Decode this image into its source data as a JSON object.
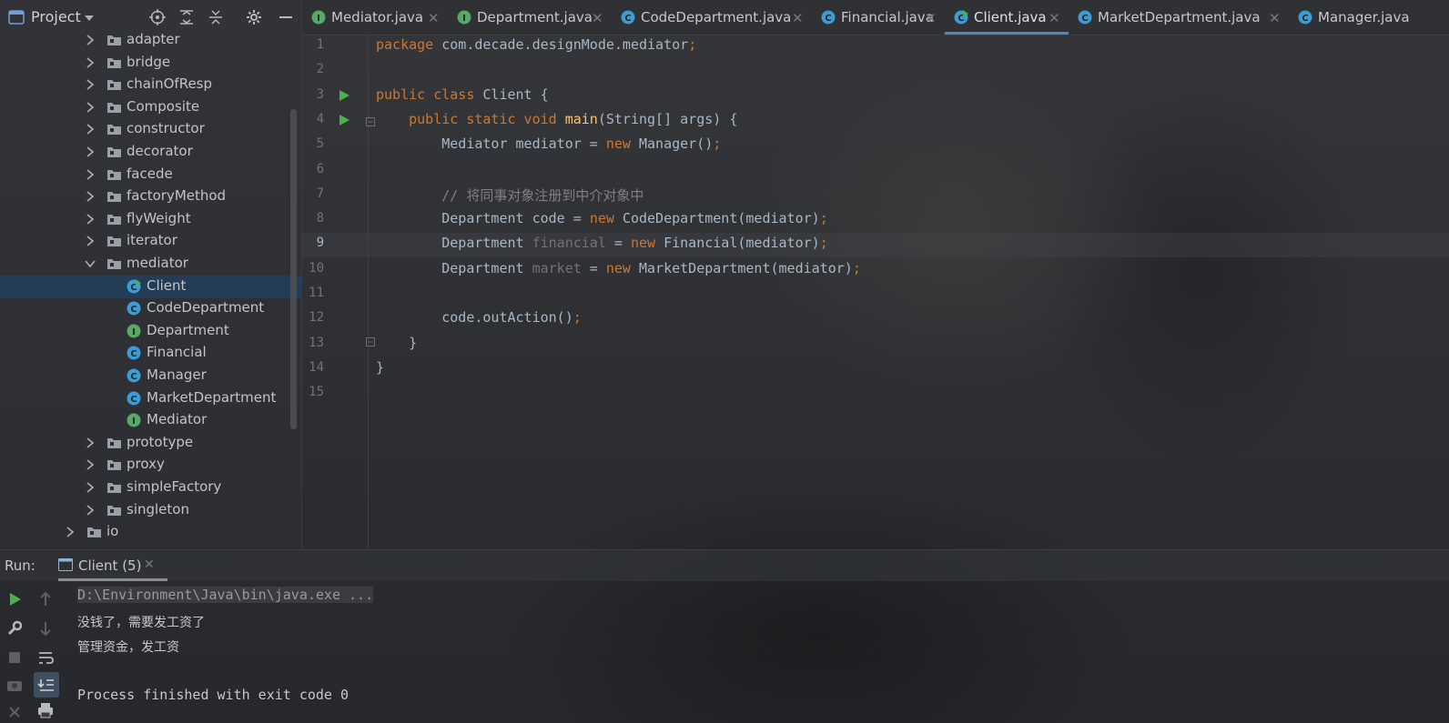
{
  "project": {
    "title": "Project",
    "tree": [
      {
        "label": "adapter",
        "kind": "folder",
        "expanded": false
      },
      {
        "label": "bridge",
        "kind": "folder",
        "expanded": false
      },
      {
        "label": "chainOfResp",
        "kind": "folder",
        "expanded": false
      },
      {
        "label": "Composite",
        "kind": "folder",
        "expanded": false
      },
      {
        "label": "constructor",
        "kind": "folder",
        "expanded": false
      },
      {
        "label": "decorator",
        "kind": "folder",
        "expanded": false
      },
      {
        "label": "facede",
        "kind": "folder",
        "expanded": false
      },
      {
        "label": "factoryMethod",
        "kind": "folder",
        "expanded": false
      },
      {
        "label": "flyWeight",
        "kind": "folder",
        "expanded": false
      },
      {
        "label": "iterator",
        "kind": "folder",
        "expanded": false
      },
      {
        "label": "mediator",
        "kind": "folder",
        "expanded": true
      },
      {
        "label": "Client",
        "kind": "class-run",
        "selected": true
      },
      {
        "label": "CodeDepartment",
        "kind": "class"
      },
      {
        "label": "Department",
        "kind": "interface"
      },
      {
        "label": "Financial",
        "kind": "class"
      },
      {
        "label": "Manager",
        "kind": "class"
      },
      {
        "label": "MarketDepartment",
        "kind": "class"
      },
      {
        "label": "Mediator",
        "kind": "interface"
      },
      {
        "label": "prototype",
        "kind": "folder",
        "expanded": false
      },
      {
        "label": "proxy",
        "kind": "folder",
        "expanded": false
      },
      {
        "label": "simpleFactory",
        "kind": "folder",
        "expanded": false
      },
      {
        "label": "singleton",
        "kind": "folder",
        "expanded": false
      },
      {
        "label": "io",
        "kind": "folder",
        "expanded": false
      }
    ]
  },
  "tabs": [
    {
      "label": "Mediator.java",
      "kind": "interface",
      "active": false
    },
    {
      "label": "Department.java",
      "kind": "interface",
      "active": false
    },
    {
      "label": "CodeDepartment.java",
      "kind": "class",
      "active": false
    },
    {
      "label": "Financial.java",
      "kind": "class",
      "active": false
    },
    {
      "label": "Client.java",
      "kind": "class-run",
      "active": true
    },
    {
      "label": "MarketDepartment.java",
      "kind": "class",
      "active": false
    },
    {
      "label": "Manager.java",
      "kind": "class",
      "active": false
    }
  ],
  "tab_close_glyph": "✕",
  "editor": {
    "current_line": 9,
    "line_numbers": [
      "1",
      "2",
      "3",
      "4",
      "5",
      "6",
      "7",
      "8",
      "9",
      "10",
      "11",
      "12",
      "13",
      "14",
      "15"
    ],
    "lines": [
      {
        "t1": "package",
        "t2": " com.decade.designMode.mediator",
        "t3": ";"
      },
      {},
      {
        "t1": "public class",
        "t2": " Client {"
      },
      {
        "t0": "    ",
        "t1": "public static void",
        "t2": " ",
        "t3": "main",
        "t4": "(String[] args) {"
      },
      {
        "t0": "        Mediator mediator = ",
        "t1": "new",
        "t2": " Manager()",
        "t3": ";"
      },
      {},
      {
        "t0": "        // 将同事对象注册到中介对象中"
      },
      {
        "t0": "        Department code = ",
        "t1": "new",
        "t2": " CodeDepartment(mediator)",
        "t3": ";"
      },
      {
        "t0": "        Department ",
        "t1": "financial",
        "t2": " = ",
        "t3": "new",
        "t4": " Financial(mediator)",
        "t5": ";"
      },
      {
        "t0": "        Department ",
        "t1": "market",
        "t2": " = ",
        "t3": "new",
        "t4": " MarketDepartment(mediator)",
        "t5": ";"
      },
      {},
      {
        "t0": "        code.outAction()",
        "t1": ";"
      },
      {
        "t0": "    }"
      },
      {
        "t0": "}"
      },
      {}
    ]
  },
  "run": {
    "label": "Run:",
    "tab_label": "Client (5)",
    "close_glyph": "✕",
    "console": [
      "D:\\Environment\\Java\\bin\\java.exe ...",
      "没钱了，需要发工资了",
      "管理资金，发工资",
      "",
      "Process finished with exit code 0"
    ]
  },
  "colors": {
    "keyword": "#cc7832",
    "method": "#ffc66d",
    "comment": "#808080",
    "selection": "#243d56",
    "run_green": "#4caf50",
    "class_icon": "#3d9bd6",
    "interface_icon": "#59a869"
  }
}
